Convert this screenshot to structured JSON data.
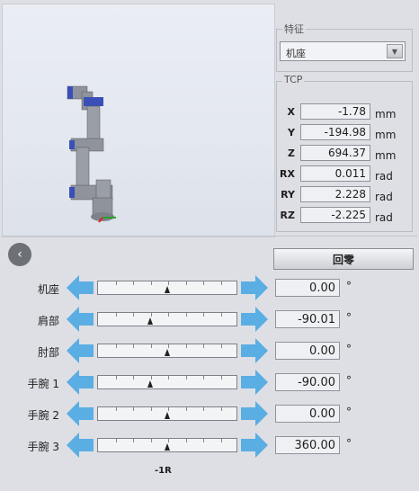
{
  "feature": {
    "label": "特征",
    "selected": "机座"
  },
  "tcp": {
    "label": "TCP",
    "rows": [
      {
        "key": "X",
        "value": "-1.78",
        "unit": "mm"
      },
      {
        "key": "Y",
        "value": "-194.98",
        "unit": "mm"
      },
      {
        "key": "Z",
        "value": "694.37",
        "unit": "mm"
      },
      {
        "key": "RX",
        "value": "0.011",
        "unit": "rad"
      },
      {
        "key": "RY",
        "value": "2.228",
        "unit": "rad"
      },
      {
        "key": "RZ",
        "value": "-2.225",
        "unit": "rad"
      }
    ]
  },
  "home_button": {
    "label": "回零"
  },
  "joints": [
    {
      "label": "机座",
      "value": "0.00",
      "unit": "°",
      "slider_fraction": 0.5
    },
    {
      "label": "肩部",
      "value": "-90.01",
      "unit": "°",
      "slider_fraction": 0.375
    },
    {
      "label": "肘部",
      "value": "0.00",
      "unit": "°",
      "slider_fraction": 0.5
    },
    {
      "label": "手腕 1",
      "value": "-90.00",
      "unit": "°",
      "slider_fraction": 0.375
    },
    {
      "label": "手腕 2",
      "value": "0.00",
      "unit": "°",
      "slider_fraction": 0.5
    },
    {
      "label": "手腕 3",
      "value": "360.00",
      "unit": "°",
      "slider_fraction": 0.5
    }
  ],
  "revolution_label": "-1R",
  "colors": {
    "arrow": "#5aaee3",
    "robot_body": "#8f939b",
    "robot_joint": "#3b4fb8"
  }
}
